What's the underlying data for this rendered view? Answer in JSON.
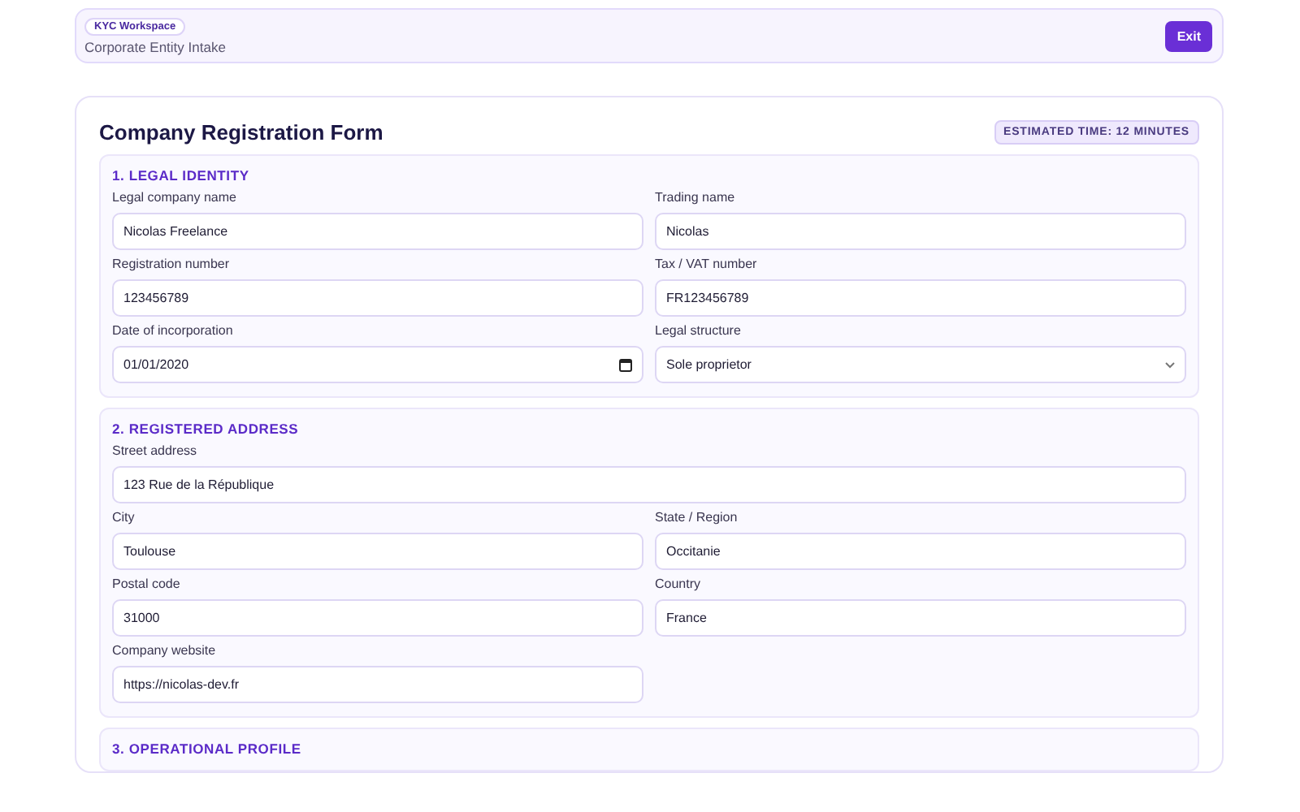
{
  "header": {
    "badge": "KYC Workspace",
    "subtitle": "Corporate Entity Intake",
    "exit_button": "Exit"
  },
  "form": {
    "title": "Company Registration Form",
    "estimate": "ESTIMATED TIME: 12 MINUTES",
    "sections": [
      {
        "title": "1. LEGAL IDENTITY",
        "fields": [
          {
            "label": "Legal company name",
            "kind": "text",
            "value": "Nicolas Freelance",
            "wide": false
          },
          {
            "label": "Trading name",
            "kind": "text",
            "value": "Nicolas",
            "wide": false
          },
          {
            "label": "Registration number",
            "kind": "text",
            "value": "123456789",
            "wide": false
          },
          {
            "label": "Tax / VAT number",
            "kind": "text",
            "value": "FR123456789",
            "wide": false
          },
          {
            "label": "Date of incorporation",
            "kind": "date",
            "value": "01/01/2020",
            "wide": false
          },
          {
            "label": "Legal structure",
            "kind": "select",
            "value": "Sole proprietor",
            "wide": false
          }
        ]
      },
      {
        "title": "2. REGISTERED ADDRESS",
        "fields": [
          {
            "label": "Street address",
            "kind": "text",
            "value": "123 Rue de la République",
            "wide": true
          },
          {
            "label": "City",
            "kind": "text",
            "value": "Toulouse",
            "wide": false
          },
          {
            "label": "State / Region",
            "kind": "text",
            "value": "Occitanie",
            "wide": false
          },
          {
            "label": "Postal code",
            "kind": "text",
            "value": "31000",
            "wide": false
          },
          {
            "label": "Country",
            "kind": "text",
            "value": "France",
            "wide": false
          },
          {
            "label": "Company website",
            "kind": "text",
            "value": "https://nicolas-dev.fr",
            "wide": false
          }
        ]
      },
      {
        "title": "3. OPERATIONAL PROFILE"
      }
    ]
  }
}
